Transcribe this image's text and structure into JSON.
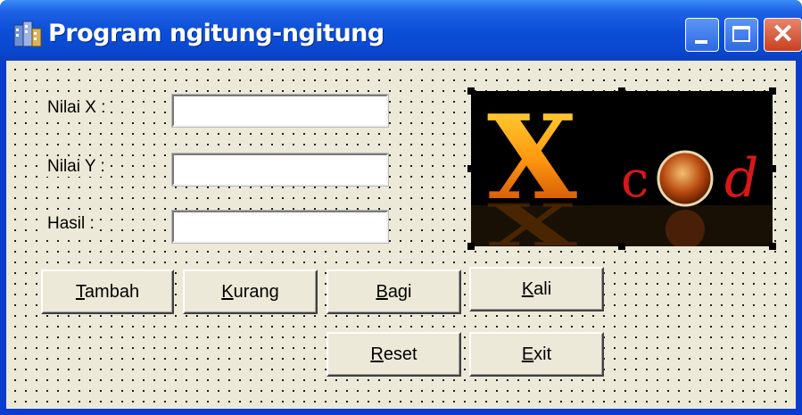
{
  "window": {
    "title": "Program ngitung-ngitung",
    "app_icon": "building-icon",
    "controls": {
      "minimize": "minimize-icon",
      "maximize": "maximize-icon",
      "close": "close-icon"
    }
  },
  "form": {
    "labels": {
      "nilai_x": "Nilai X :",
      "nilai_y": "Nilai Y :",
      "hasil": "Hasil :"
    },
    "inputs": {
      "nilai_x": "",
      "nilai_y": "",
      "hasil": ""
    },
    "picture": {
      "text_big": "X",
      "text_small": "c",
      "text_tail": "d"
    },
    "buttons": {
      "tambah": {
        "mnemonic": "T",
        "rest": "ambah"
      },
      "kurang": {
        "mnemonic": "K",
        "rest": "urang"
      },
      "bagi": {
        "mnemonic": "B",
        "rest": "agi"
      },
      "kali": {
        "mnemonic": "K",
        "rest": "ali"
      },
      "reset": {
        "mnemonic": "R",
        "rest": "eset"
      },
      "exit": {
        "mnemonic": "E",
        "rest": "xit"
      }
    }
  },
  "colors": {
    "title_bar": "#0a47cf",
    "form_bg": "#ece9d8",
    "close_button": "#c9401f"
  }
}
